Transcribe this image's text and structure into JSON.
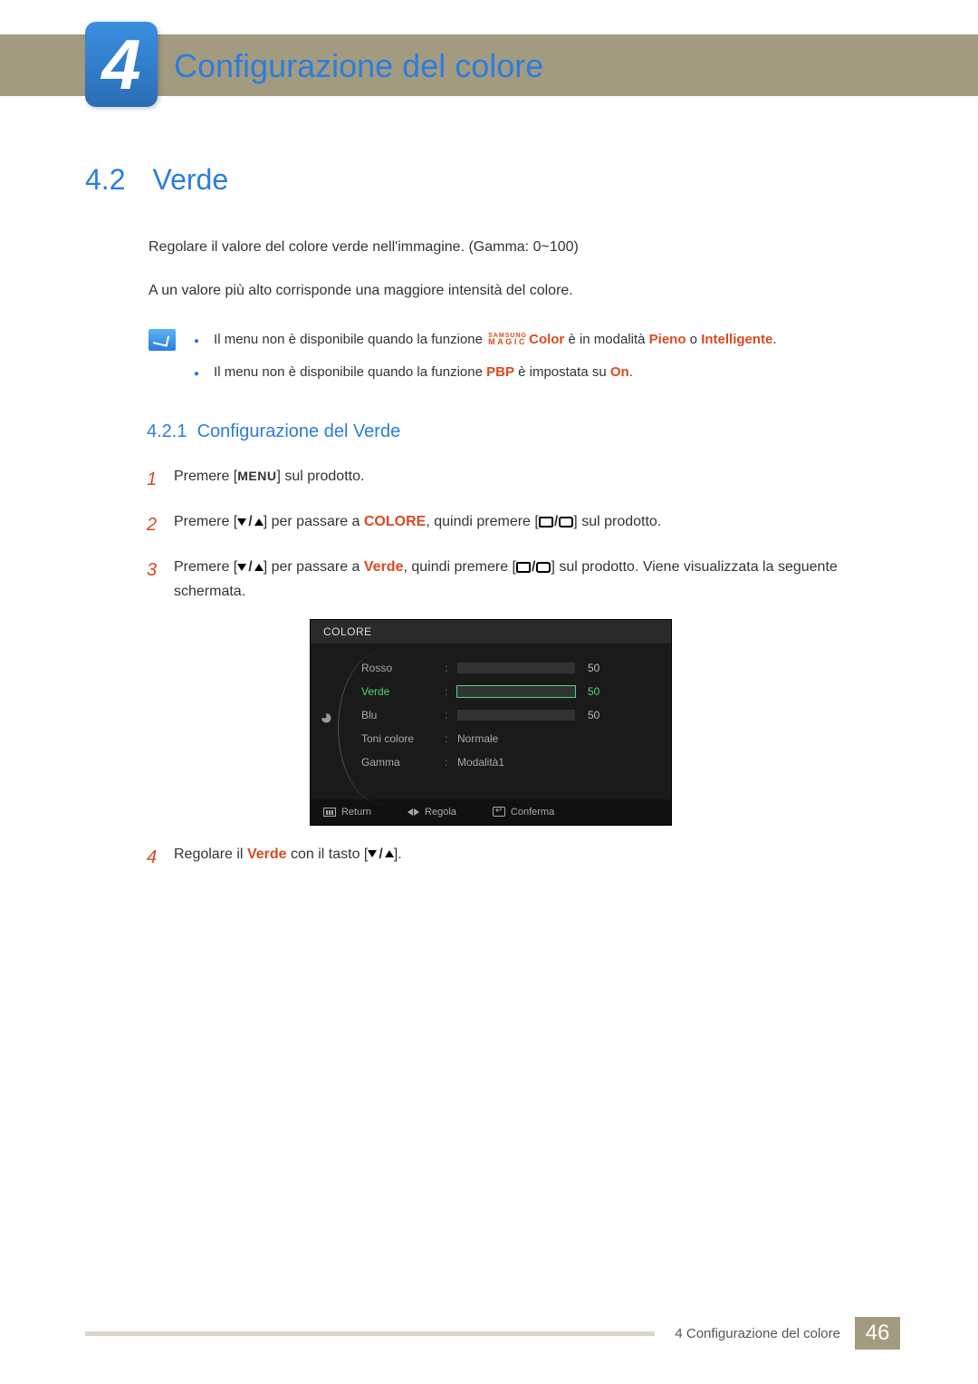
{
  "chapter": {
    "number": "4",
    "title": "Configurazione del colore"
  },
  "section": {
    "number": "4.2",
    "title": "Verde"
  },
  "intro": {
    "p1": "Regolare il valore del colore verde nell'immagine. (Gamma: 0~100)",
    "p2": "A un valore più alto corrisponde una maggiore intensità del colore."
  },
  "info": {
    "line1_a": "Il menu non è disponibile quando la funzione ",
    "magic_top": "SAMSUNG",
    "magic_bottom": "MAGIC",
    "magic_suffix": "Color",
    "line1_b": " è in modalità ",
    "mode_a": "Pieno",
    "line1_or": " o ",
    "mode_b": "Intelligente",
    "line1_end": ".",
    "line2_a": "Il menu non è disponibile quando la funzione ",
    "pbp": "PBP",
    "line2_b": " è impostata su ",
    "on": "On",
    "line2_end": "."
  },
  "subsection": {
    "number": "4.2.1",
    "title": "Configurazione del Verde"
  },
  "steps": {
    "s1_a": "Premere [",
    "s1_menu": "MENU",
    "s1_b": "] sul prodotto.",
    "s2_a": "Premere [",
    "s2_b": "] per passare a ",
    "s2_color": "COLORE",
    "s2_c": ", quindi premere [",
    "s2_d": "] sul prodotto.",
    "s3_a": "Premere [",
    "s3_b": "] per passare a ",
    "s3_verde": "Verde",
    "s3_c": ", quindi premere [",
    "s3_d": "] sul prodotto. Viene visualizzata la seguente schermata.",
    "s4_a": "Regolare il ",
    "s4_verde": "Verde",
    "s4_b": " con il tasto [",
    "s4_c": "]."
  },
  "osd": {
    "title": "COLORE",
    "rows": [
      {
        "label": "Rosso",
        "value": 50,
        "bar": 50,
        "selected": false
      },
      {
        "label": "Verde",
        "value": 50,
        "bar": 50,
        "selected": true
      },
      {
        "label": "Blu",
        "value": 50,
        "bar": 50,
        "selected": false
      }
    ],
    "toni_label": "Toni colore",
    "toni_value": "Normale",
    "gamma_label": "Gamma",
    "gamma_value": "Modalità1",
    "footer": {
      "return": "Return",
      "regola": "Regola",
      "conferma": "Conferma"
    }
  },
  "footer": {
    "text": "4 Configurazione del colore",
    "page": "46"
  }
}
